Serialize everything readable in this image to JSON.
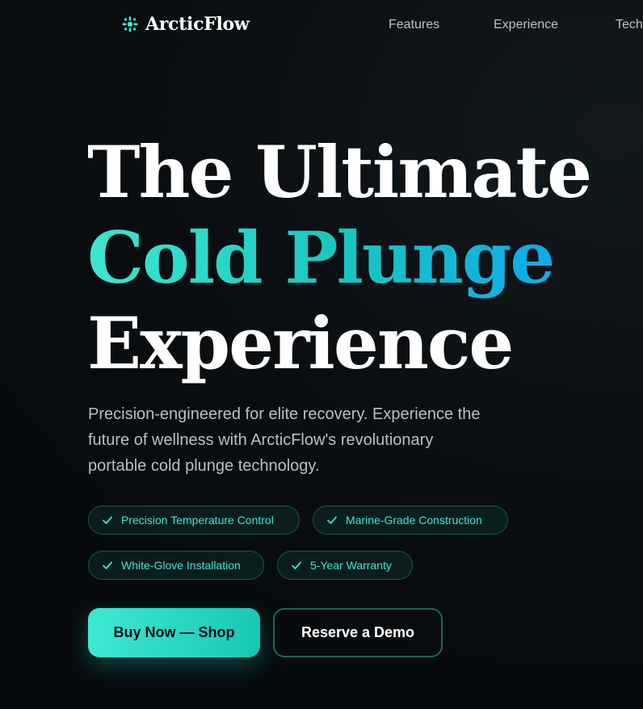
{
  "nav": {
    "brand": "ArcticFlow",
    "brand_icon": "snowflake-icon",
    "links": [
      "Features",
      "Experience",
      "Tech"
    ]
  },
  "hero": {
    "title_line1": "The Ultimate",
    "title_line2": "Cold Plunge",
    "title_line3": "Experience",
    "description": "Precision-engineered for elite recovery. Experience the future of wellness with ArcticFlow's revolutionary portable cold plunge technology.",
    "features": [
      "Precision Temperature Control",
      "Marine-Grade Construction",
      "White-Glove Installation",
      "5-Year Warranty"
    ],
    "feature_icon": "check-icon",
    "primary_cta": "Buy Now — Shop",
    "secondary_cta": "Reserve a Demo"
  },
  "colors": {
    "background": "#0b0f12",
    "accent": "#2dd4bf",
    "accent_blue": "#0ea5f0",
    "text_muted": "#b5c0c8"
  }
}
